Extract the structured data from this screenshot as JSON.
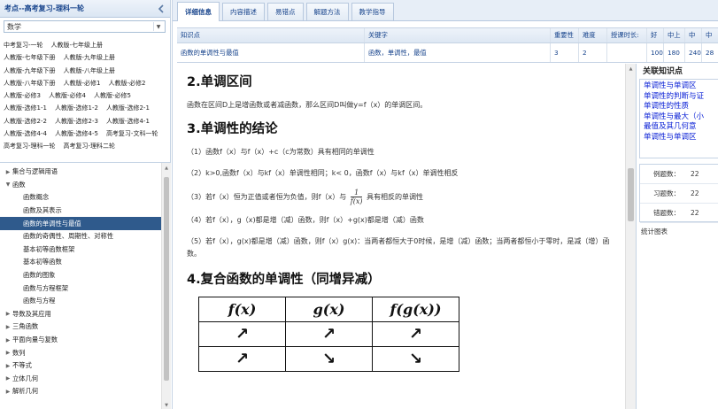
{
  "left_panel": {
    "title": "考点--高考复习-理科一轮",
    "subject_value": "数学",
    "books": [
      [
        "中考复习-一轮",
        "人教版-七年级上册"
      ],
      [
        "人教版-七年级下册",
        "人教版-九年级上册"
      ],
      [
        "人教版-九年级下册",
        "人教版-八年级上册"
      ],
      [
        "人教版-八年级下册",
        "人教版-必修1",
        "人教版-必修2"
      ],
      [
        "人教版-必修3",
        "人教版-必修4",
        "人教版-必修5"
      ],
      [
        "人教版-选修1-1",
        "人教版-选修1-2",
        "人教版-选修2-1"
      ],
      [
        "人教版-选修2-2",
        "人教版-选修2-3",
        "人教版-选修4-1"
      ],
      [
        "人教版-选修4-4",
        "人教版-选修4-5",
        "高考复习-文科一轮"
      ],
      [
        "高考复习-理科一轮",
        "高考复习-理科二轮"
      ]
    ],
    "tree": [
      {
        "label": "集合与逻辑用语",
        "level": 0,
        "arrow": "▶"
      },
      {
        "label": "函数",
        "level": 0,
        "arrow": "▼"
      },
      {
        "label": "函数概念",
        "level": 1
      },
      {
        "label": "函数及其表示",
        "level": 1
      },
      {
        "label": "函数的单调性与最值",
        "level": 1,
        "selected": true
      },
      {
        "label": "函数的奇偶性、周期性、对称性",
        "level": 1
      },
      {
        "label": "基本初等函数框架",
        "level": 1
      },
      {
        "label": "基本初等函数",
        "level": 1
      },
      {
        "label": "函数的图象",
        "level": 1
      },
      {
        "label": "函数与方程框架",
        "level": 1
      },
      {
        "label": "函数与方程",
        "level": 1
      },
      {
        "label": "导数及其应用",
        "level": 0,
        "arrow": "▶"
      },
      {
        "label": "三角函数",
        "level": 0,
        "arrow": "▶"
      },
      {
        "label": "平面向量与复数",
        "level": 0,
        "arrow": "▶"
      },
      {
        "label": "数列",
        "level": 0,
        "arrow": "▶"
      },
      {
        "label": "不等式",
        "level": 0,
        "arrow": "▶"
      },
      {
        "label": "立体几何",
        "level": 0,
        "arrow": "▶"
      },
      {
        "label": "解析几何",
        "level": 0,
        "arrow": "▶"
      }
    ]
  },
  "tabs": [
    {
      "label": "详细信息",
      "active": true
    },
    {
      "label": "内容描述"
    },
    {
      "label": "易错点"
    },
    {
      "label": "解题方法"
    },
    {
      "label": "教学指导"
    }
  ],
  "table": {
    "headers": [
      "知识点",
      "关键字",
      "重要性",
      "难度",
      "授课时长:",
      "好",
      "中上",
      "中",
      "中"
    ],
    "row": [
      "函数的单调性与最值",
      "函数，单调性，最值",
      "3",
      "2",
      "",
      "100",
      "180",
      "240",
      "28"
    ]
  },
  "content": {
    "h_interval": "2.单调区间",
    "p_interval": "函数在区间D上是增函数或者减函数，那么区间D叫做y=f（x）的单调区间。",
    "h_conclusion": "3.单调性的结论",
    "items": [
      "（1）函数f（x）与f（x）+c（c为常数）具有相同的单调性",
      "（2）k>0,函数f（x）与kf（x）单调性相同；k< 0，函数f（x）与kf（x）单调性相反",
      "（4）若f（x），g（x)都是增（减）函数，则f（x）+g(x)都是增（减）函数",
      "（5）若f（x），g(x)都是增（减）函数，则f（x）g(x)：当两者都恒大于0时候，是增（减）函数；当两者都恒小于零时，是减（增）函数。"
    ],
    "item3_before": "（3）若f（x）恒为正值或者恒为负值，则f（x）与",
    "item3_num": "1",
    "item3_den": "f(x)",
    "item3_after": "具有相反的单调性",
    "h_composite": "4.复合函数的单调性（同增异减）",
    "table_headers": [
      "f(x)",
      "g(x)",
      "f(g(x))"
    ],
    "table_rows": [
      [
        "↗",
        "↗",
        "↗"
      ],
      [
        "↗",
        "↘",
        "↘"
      ]
    ]
  },
  "related": {
    "title": "关联知识点",
    "items": [
      "单调性与单调区",
      "单调性的判断与证",
      "单调性的性质",
      "单调性与最大（小",
      "最值及其几何意",
      "单调性与单调区"
    ],
    "stats": [
      {
        "label": "例题数：",
        "value": "22"
      },
      {
        "label": "习题数：",
        "value": "22"
      },
      {
        "label": "错题数：",
        "value": "22"
      }
    ],
    "chart_label": "统计图表"
  }
}
